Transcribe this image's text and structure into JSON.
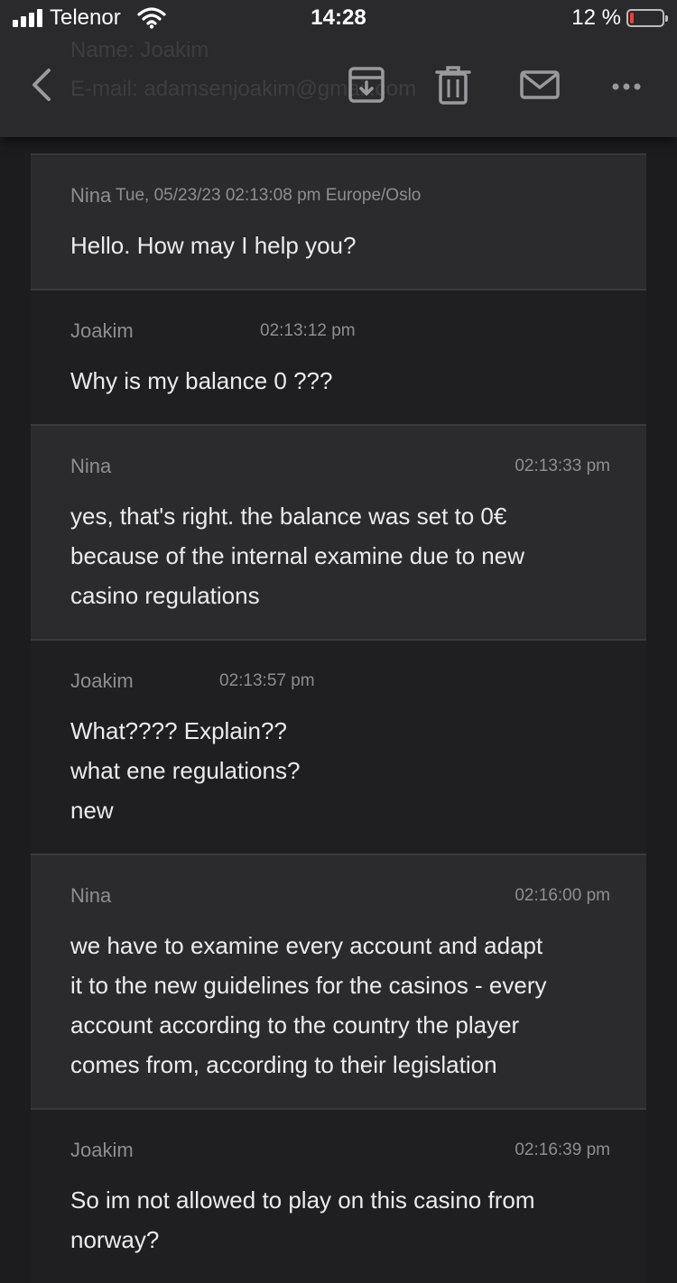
{
  "status_bar": {
    "carrier": "Telenor",
    "time": "14:28",
    "battery_text": "12 %",
    "battery_level": 0.12,
    "battery_color": "#ff3b30"
  },
  "toolbar": {
    "ghost_name": "Name:  Joakim",
    "ghost_email": "E-mail:  adamsenjoakim@gmail.com",
    "icons": [
      "chevron-left-icon",
      "archive-icon",
      "trash-icon",
      "mail-icon",
      "more-icon"
    ]
  },
  "messages": [
    {
      "sender": "Nina",
      "timestamp": "Tue, 05/23/23  02:13:08 pm  Europe/Oslo",
      "lines": [
        "Hello. How may I help you?"
      ]
    },
    {
      "sender": "Joakim",
      "timestamp": "02:13:12 pm",
      "lines": [
        "Why is my balance 0 ???"
      ]
    },
    {
      "sender": "Nina",
      "timestamp": "02:13:33 pm",
      "lines": [
        "yes, that's right. the balance was set to 0€",
        "because of the internal examine due to new",
        "casino regulations"
      ]
    },
    {
      "sender": "Joakim",
      "timestamp": "02:13:57 pm",
      "lines": [
        "What???? Explain??",
        "what ene regulations?",
        "new"
      ]
    },
    {
      "sender": "Nina",
      "timestamp": "02:16:00 pm",
      "lines": [
        "we have to examine every account and adapt",
        "it to the new guidelines for the casinos - every",
        "account according to the country the player",
        "comes from, according to their legislation"
      ]
    },
    {
      "sender": "Joakim",
      "timestamp": "02:16:39 pm",
      "lines": [
        "So im not allowed to play on this casino from",
        "norway?"
      ]
    }
  ]
}
